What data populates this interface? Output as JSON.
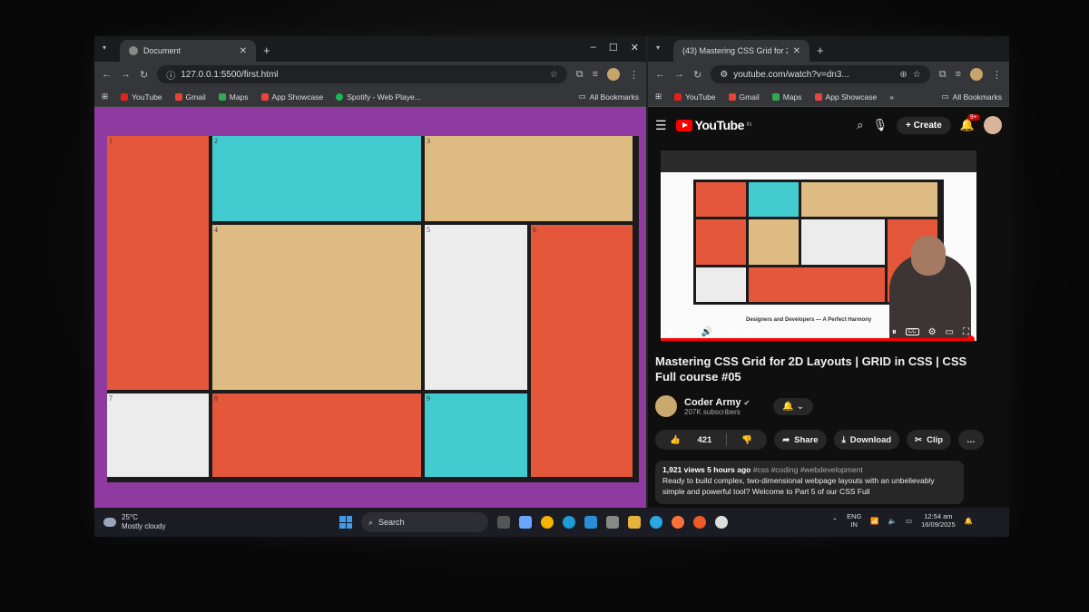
{
  "left_window": {
    "tab_title": "Document",
    "url": "127.0.0.1:5500/first.html",
    "bookmarks": [
      {
        "label": "YouTube",
        "color": "#e62117"
      },
      {
        "label": "Gmail",
        "color": "#ea4335"
      },
      {
        "label": "Maps",
        "color": "#34a853"
      },
      {
        "label": "App Showcase",
        "color": "#e8453c"
      },
      {
        "label": "Spotify - Web Playe...",
        "color": "#1db954"
      }
    ],
    "all_bookmarks": "All Bookmarks",
    "page_bg": "#8f3aa0",
    "cells": [
      {
        "num": "1",
        "color": "#e5573a"
      },
      {
        "num": "2",
        "color": "#43ccd0"
      },
      {
        "num": "3",
        "color": "#dfbb84"
      },
      {
        "num": "4",
        "color": "#dfbb84"
      },
      {
        "num": "5",
        "color": "#ececec"
      },
      {
        "num": "6",
        "color": "#e5573a"
      },
      {
        "num": "7",
        "color": "#ececec"
      },
      {
        "num": "8",
        "color": "#e5573a"
      },
      {
        "num": "9",
        "color": "#43ccd0"
      }
    ]
  },
  "right_window": {
    "tab_title": "(43) Mastering CSS Grid for 2D",
    "url": "youtube.com/watch?v=dn3...",
    "bookmarks": [
      {
        "label": "YouTube",
        "color": "#e62117"
      },
      {
        "label": "Gmail",
        "color": "#ea4335"
      },
      {
        "label": "Maps",
        "color": "#34a853"
      },
      {
        "label": "App Showcase",
        "color": "#e8453c"
      }
    ],
    "all_bookmarks": "All Bookmarks",
    "youtube": {
      "logo": "YouTube",
      "region": "IN",
      "create_label": "Create",
      "notif_badge": "9+",
      "video": {
        "caption": "Designers and Developers — A Perfect Harmony",
        "time": "55:30 / 56:24",
        "progress": 0.984
      },
      "title": "Mastering CSS Grid for 2D Layouts | GRID in CSS | CSS Full course #05",
      "channel": "Coder Army",
      "subscribers": "207K subscribers",
      "likes": "421",
      "share_label": "Share",
      "download_label": "Download",
      "clip_label": "Clip",
      "more_label": "…",
      "views": "1,921 views",
      "uploaded": "5 hours ago",
      "tags": "#css #coding #webdevelopment",
      "description": "Ready to build complex, two-dimensional webpage layouts with an unbelievably simple and powerful tool? Welcome to Part 5 of our CSS Full"
    }
  },
  "taskbar": {
    "temp": "25°C",
    "weather": "Mostly cloudy",
    "search": "Search",
    "lang_top": "ENG",
    "lang_bottom": "IN",
    "time": "12:54 am",
    "date": "16/09/2025"
  }
}
